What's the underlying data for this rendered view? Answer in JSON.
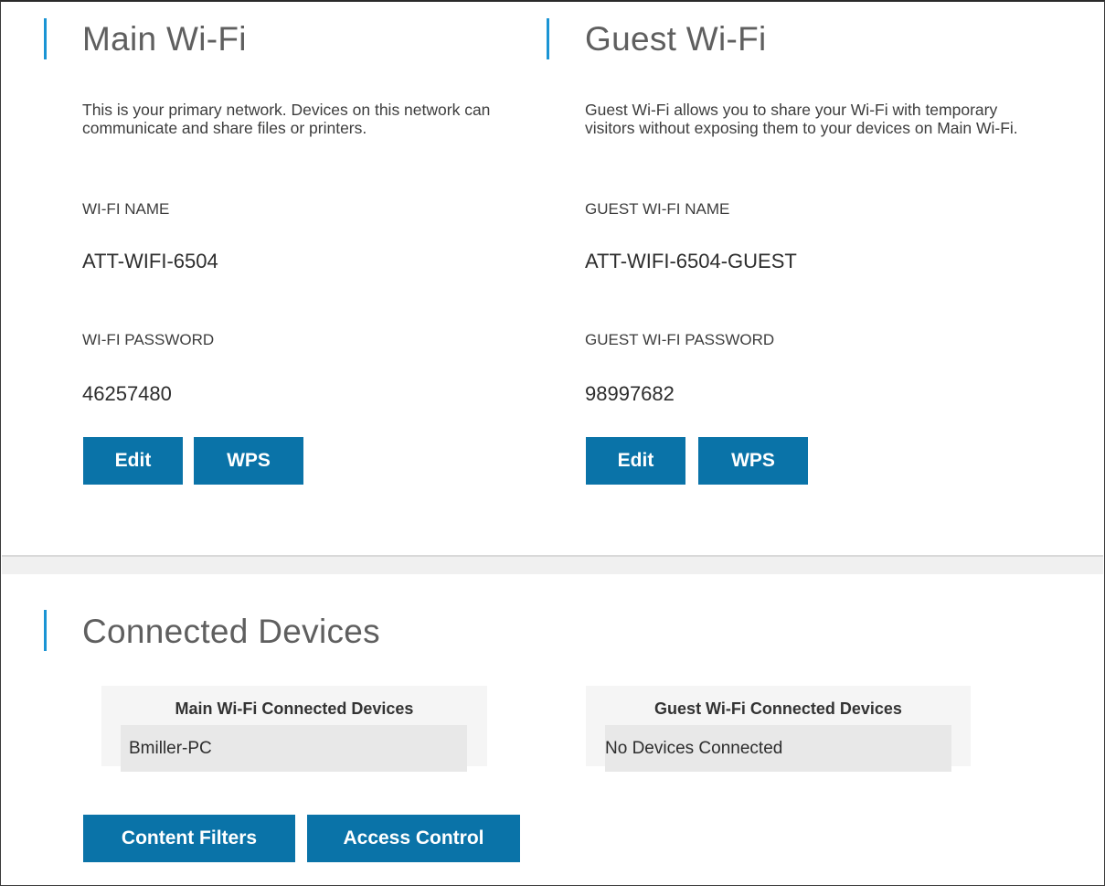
{
  "main_wifi": {
    "title": "Main Wi-Fi",
    "description": "This is your primary network. Devices on this network can communicate and share files or printers.",
    "name_label": "WI-FI NAME",
    "name_value": "ATT-WIFI-6504",
    "password_label": "WI-FI PASSWORD",
    "password_value": "46257480",
    "edit_label": "Edit",
    "wps_label": "WPS"
  },
  "guest_wifi": {
    "title": "Guest Wi-Fi",
    "description": "Guest Wi-Fi allows you to share your Wi-Fi with temporary visitors without exposing them to your devices on Main Wi-Fi.",
    "name_label": "GUEST WI-FI NAME",
    "name_value": "ATT-WIFI-6504-GUEST",
    "password_label": "GUEST WI-FI PASSWORD",
    "password_value": "98997682",
    "edit_label": "Edit",
    "wps_label": "WPS"
  },
  "connected_devices": {
    "title": "Connected Devices",
    "main_panel": {
      "title": "Main Wi-Fi Connected Devices",
      "devices": [
        "Bmiller-PC"
      ]
    },
    "guest_panel": {
      "title": "Guest Wi-Fi Connected Devices",
      "devices": [
        "No Devices Connected"
      ]
    },
    "content_filters_label": "Content Filters",
    "access_control_label": "Access Control"
  },
  "colors": {
    "accent": "#1a94d4",
    "button": "#0a73a8"
  }
}
